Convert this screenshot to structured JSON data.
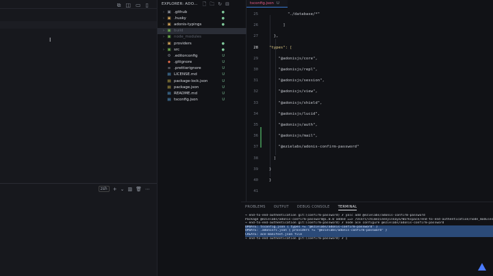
{
  "explorer": {
    "title": "EXPLORER: ADO...",
    "items": [
      {
        "label": ".github",
        "chev": "›",
        "icon": "▣",
        "iconColor": "#8a8f99",
        "status": "●",
        "dim": false,
        "sel": false
      },
      {
        "label": ".husky",
        "chev": "›",
        "icon": "▣",
        "iconColor": "#d7a85b",
        "status": "●",
        "dim": false,
        "sel": false
      },
      {
        "label": "adonis-typings",
        "chev": "›",
        "icon": "▣",
        "iconColor": "#d7a85b",
        "status": "●",
        "dim": false,
        "sel": false
      },
      {
        "label": "build",
        "chev": "›",
        "icon": "▣",
        "iconColor": "#6fb04f",
        "status": "",
        "dim": true,
        "sel": true
      },
      {
        "label": "node_modules",
        "chev": "›",
        "icon": "▣",
        "iconColor": "#6fb04f",
        "status": "",
        "dim": true,
        "sel": false
      },
      {
        "label": "providers",
        "chev": "›",
        "icon": "▣",
        "iconColor": "#d7a85b",
        "status": "●",
        "dim": false,
        "sel": false
      },
      {
        "label": "src",
        "chev": "›",
        "icon": "▣",
        "iconColor": "#6fb04f",
        "status": "●",
        "dim": false,
        "sel": false
      },
      {
        "label": ".editorconfig",
        "chev": "",
        "icon": "⚙",
        "iconColor": "#8a8f99",
        "status": "U",
        "dim": false,
        "sel": false
      },
      {
        "label": ".gitignore",
        "chev": "",
        "icon": "◆",
        "iconColor": "#e36c4a",
        "status": "U",
        "dim": false,
        "sel": false
      },
      {
        "label": ".prettierignore",
        "chev": "",
        "icon": "≡",
        "iconColor": "#8a8f99",
        "status": "U",
        "dim": false,
        "sel": false
      },
      {
        "label": "LICENSE.md",
        "chev": "",
        "icon": "▤",
        "iconColor": "#5ba6e0",
        "status": "U",
        "dim": false,
        "sel": false
      },
      {
        "label": "package-lock.json",
        "chev": "",
        "icon": "▤",
        "iconColor": "#cfb64b",
        "status": "U",
        "dim": false,
        "sel": false
      },
      {
        "label": "package.json",
        "chev": "",
        "icon": "▤",
        "iconColor": "#cfb64b",
        "status": "U",
        "dim": false,
        "sel": false
      },
      {
        "label": "README.md",
        "chev": "",
        "icon": "▤",
        "iconColor": "#5ba6e0",
        "status": "U",
        "dim": false,
        "sel": false
      },
      {
        "label": "tsconfig.json",
        "chev": "",
        "icon": "▤",
        "iconColor": "#5ba6e0",
        "status": "U",
        "dim": false,
        "sel": false
      }
    ]
  },
  "editor": {
    "tab_label": "tsconfig.json",
    "tab_status": "U",
    "lines": [
      {
        "no": "25",
        "code": "        \"./database/*\"",
        "type": "str"
      },
      {
        "no": "26",
        "code": "      ]",
        "type": "plain"
      },
      {
        "no": "27",
        "code": "  },",
        "type": "plain"
      },
      {
        "no": "28",
        "code": "\"types\": [",
        "type": "key"
      },
      {
        "no": "29",
        "code": "    \"@adonisjs/core\",",
        "type": "str"
      },
      {
        "no": "30",
        "code": "    \"@adonisjs/repl\",",
        "type": "str"
      },
      {
        "no": "31",
        "code": "    \"@adonisjs/session\",",
        "type": "str"
      },
      {
        "no": "32",
        "code": "    \"@adonisjs/view\",",
        "type": "str"
      },
      {
        "no": "33",
        "code": "    \"@adonisjs/shield\",",
        "type": "str"
      },
      {
        "no": "34",
        "code": "    \"@adonisjs/lucid\",",
        "type": "str"
      },
      {
        "no": "35",
        "code": "    \"@adonisjs/auth\",",
        "type": "str"
      },
      {
        "no": "36",
        "code": "    \"@adonisjs/mail\",",
        "type": "str"
      },
      {
        "no": "37",
        "code": "    \"@ezielabs/adonis-confirm-password\"",
        "type": "str"
      },
      {
        "no": "38",
        "code": "  ]",
        "type": "plain"
      },
      {
        "no": "39",
        "code": "}",
        "type": "plain"
      },
      {
        "no": "40",
        "code": "}",
        "type": "plain"
      },
      {
        "no": "41",
        "code": "",
        "type": "plain"
      }
    ],
    "current_line": "28"
  },
  "panel": {
    "tabs": [
      "PROBLEMS",
      "OUTPUT",
      "DEBUG CONSOLE",
      "TERMINAL"
    ],
    "active_tab": "TERMINAL",
    "terminal": [
      {
        "text": "→ end-to-end-authentication git:(confirm-password) ✗ yalc add @ezielabs/adonis-confirm-password",
        "hl": false
      },
      {
        "text": "Package @ezielabs/adonis-confirm-password@1.0.0 added ==> /Users/chimezieenyinnaya/Workspace/end-to-end-authentication/node_modules/@ezielabs/adonis-confirm-password",
        "hl": false
      },
      {
        "text": "→ end-to-end-authentication git:(confirm-password) ✗ node ace configure @ezielabs/adonis-confirm-password",
        "hl": false
      },
      {
        "text": "UPDATE: tsconfig.json { types += \"@ezielabs/adonis-confirm-password\" }",
        "hl": true
      },
      {
        "text": "UPDATE: .adonisrc.json { providers += \"@ezielabs/adonis-confirm-password\" }",
        "hl": true
      },
      {
        "text": "CREATE: ace-manifest.json file",
        "hl": true
      },
      {
        "text": "→ end-to-end-authentication git:(confirm-password) ✗ ▯",
        "hl": false
      }
    ]
  },
  "left": {
    "term_label": "zsh",
    "cursor_glyph": "I"
  }
}
